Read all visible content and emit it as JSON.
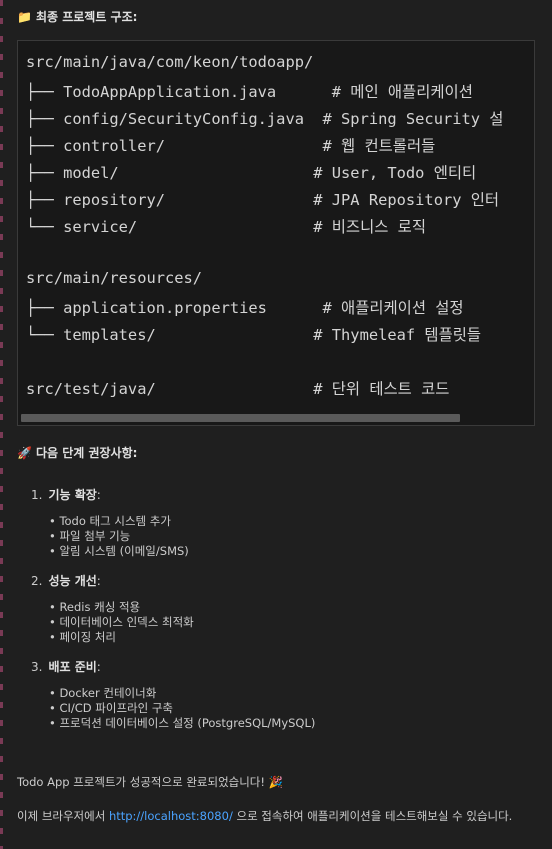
{
  "structure_heading": {
    "icon": "folder-icon",
    "emoji": "📁",
    "text": "최종 프로젝트 구조:"
  },
  "code_lines": [
    "src/main/java/com/keon/todoapp/",
    "├── TodoAppApplication.java      # 메인 애플리케이션",
    "├── config/SecurityConfig.java  # Spring Security 설",
    "├── controller/                 # 웹 컨트롤러들",
    "├── model/                     # User, Todo 엔티티",
    "├── repository/                # JPA Repository 인터",
    "└── service/                   # 비즈니스 로직",
    "",
    "src/main/resources/",
    "├── application.properties      # 애플리케이션 설정",
    "└── templates/                 # Thymeleaf 템플릿들",
    "",
    "src/test/java/                 # 단위 테스트 코드"
  ],
  "next_heading": {
    "icon": "rocket-icon",
    "emoji": "🚀",
    "text": "다음 단계 권장사항:"
  },
  "sections": [
    {
      "num": "1.",
      "title": "기능 확장",
      "items": [
        "Todo 태그 시스템 추가",
        "파일 첨부 기능",
        "알림 시스템 (이메일/SMS)"
      ]
    },
    {
      "num": "2.",
      "title": "성능 개선",
      "items": [
        "Redis 캐싱 적용",
        "데이터베이스 인덱스 최적화",
        "페이징 처리"
      ]
    },
    {
      "num": "3.",
      "title": "배포 준비",
      "items": [
        "Docker 컨테이너화",
        "CI/CD 파이프라인 구축",
        "프로덕션 데이터베이스 설정 (PostgreSQL/MySQL)"
      ]
    }
  ],
  "done_message": "Todo App 프로젝트가 성공적으로 완료되었습니다! 🎉",
  "final_message": {
    "before": "이제 브라우저에서 ",
    "link": "http://localhost:8080/",
    "after": " 으로 접속하여 애플리케이션을 테스트해보실 수 있습니다."
  }
}
